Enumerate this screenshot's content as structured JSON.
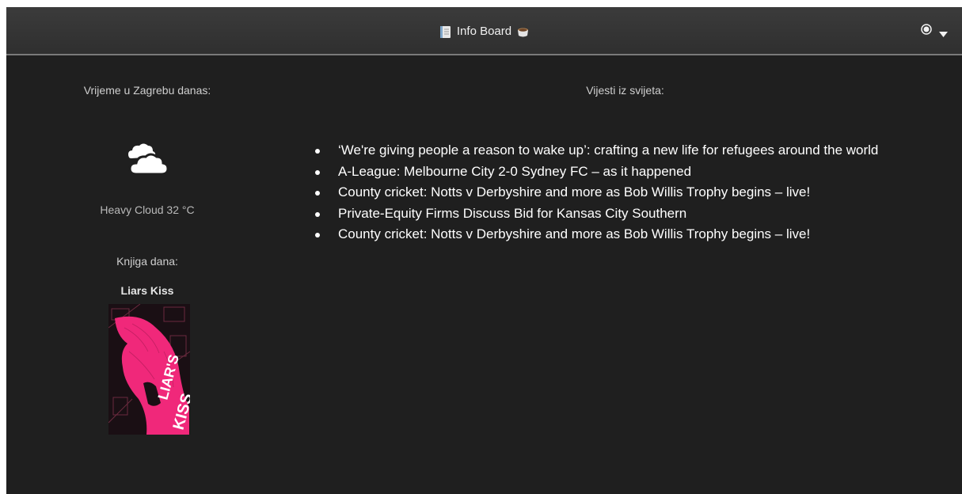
{
  "window": {
    "title": "Info Board",
    "title_icon": "notebook-icon",
    "title_emoji_icon": "coffee-icon",
    "controls": [
      "radio-icon",
      "caret-down-icon"
    ]
  },
  "weather": {
    "heading": "Vrijeme u Zagrebu danas:",
    "icon": "cloud-icon",
    "description": "Heavy Cloud 32 °C"
  },
  "book": {
    "heading": "Knjiga dana:",
    "title": "Liars Kiss",
    "cover_text": "LIAR'S KISS",
    "cover_accent": "#f0287a"
  },
  "news": {
    "heading": "Vijesti iz svijeta:",
    "items": [
      "‘We're giving people a reason to wake up’: crafting a new life for refugees around the world",
      "A-League: Melbourne City 2-0 Sydney FC – as it happened",
      "County cricket: Notts v Derbyshire and more as Bob Willis Trophy begins – live!",
      "Private-Equity Firms Discuss Bid for Kansas City Southern",
      "County cricket: Notts v Derbyshire and more as Bob Willis Trophy begins – live!"
    ]
  },
  "colors": {
    "background": "#1f1f1f",
    "titlebar": "#353535",
    "text": "#ffffff",
    "muted_text": "#c9c9c9"
  }
}
